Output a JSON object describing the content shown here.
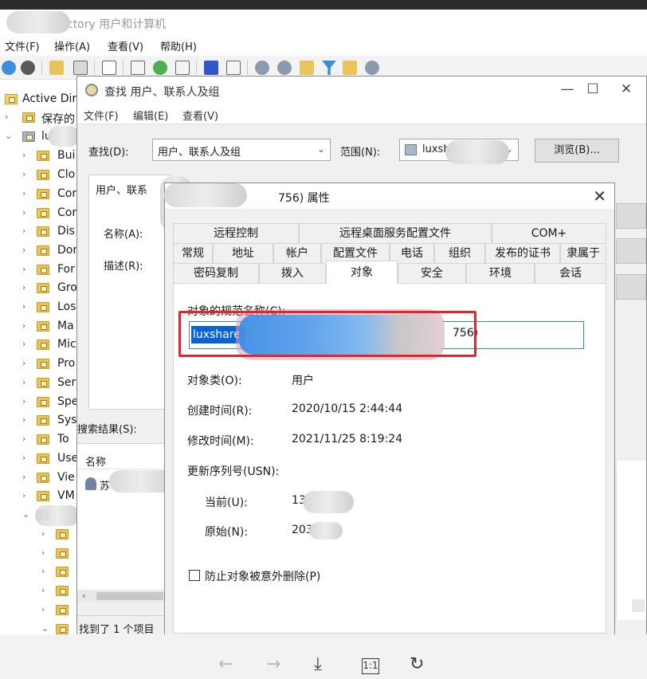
{
  "main_window": {
    "title": "ctory 用户和计算机",
    "menu": [
      "文件(F)",
      "操作(A)",
      "查看(V)",
      "帮助(H)"
    ]
  },
  "tree": {
    "root_label": "Active Dir",
    "saved_label": "保存的",
    "domain_label": "lu",
    "items": [
      "Bui",
      "Clo",
      "Cor",
      "Cor",
      "Dis",
      "Dor",
      "For",
      "Gro",
      "Los",
      "Ma",
      "Mic",
      "Pro",
      "Ser",
      "Spe",
      "Sys",
      "To",
      "Use",
      "Vie",
      "VM"
    ]
  },
  "find_dialog": {
    "title": "查找 用户、联系人及组",
    "menu": [
      "文件(F)",
      "编辑(E)",
      "查看(V)"
    ],
    "find_label": "查找(D):",
    "find_value": "用户、联系人及组",
    "scope_label": "范围(N):",
    "scope_value": "luxsh",
    "browse_button": "浏览(B)...",
    "query_tab": "用户、联系",
    "name_label": "名称(A):",
    "desc_label": "描述(R):",
    "results_label": "搜索结果(S):",
    "column_name": "名称",
    "result_item": "苏",
    "status": "找到了 1 个项目"
  },
  "props_dialog": {
    "title": "756) 属性",
    "tabs_row1": [
      "远程控制",
      "远程桌面服务配置文件",
      "COM+"
    ],
    "tabs_row2": [
      "常规",
      "地址",
      "帐户",
      "配置文件",
      "电话",
      "组织",
      "发布的证书",
      "隶属于"
    ],
    "tabs_row3": [
      "密码复制",
      "拨入",
      "对象",
      "安全",
      "环境",
      "会话"
    ],
    "active_tab": "对象",
    "dn_label": "对象的规范名称(C):",
    "dn_value_start": "luxshare.",
    "dn_value_end": "756)",
    "object_class_label": "对象类(O):",
    "object_class_value": "用户",
    "created_label": "创建时间(R):",
    "created_value": "2020/10/15 2:44:44",
    "modified_label": "修改时间(M):",
    "modified_value": "2021/11/25 8:19:24",
    "usn_label": "更新序列号(USN):",
    "current_label": "当前(U):",
    "current_value": "13",
    "original_label": "原始(N):",
    "original_value": "203",
    "protect_label": "防止对象被意外删除(P)"
  },
  "colors": {
    "selection": "#0a64d6",
    "highlight_box": "#e4252b",
    "folder": "#e8c45a"
  }
}
